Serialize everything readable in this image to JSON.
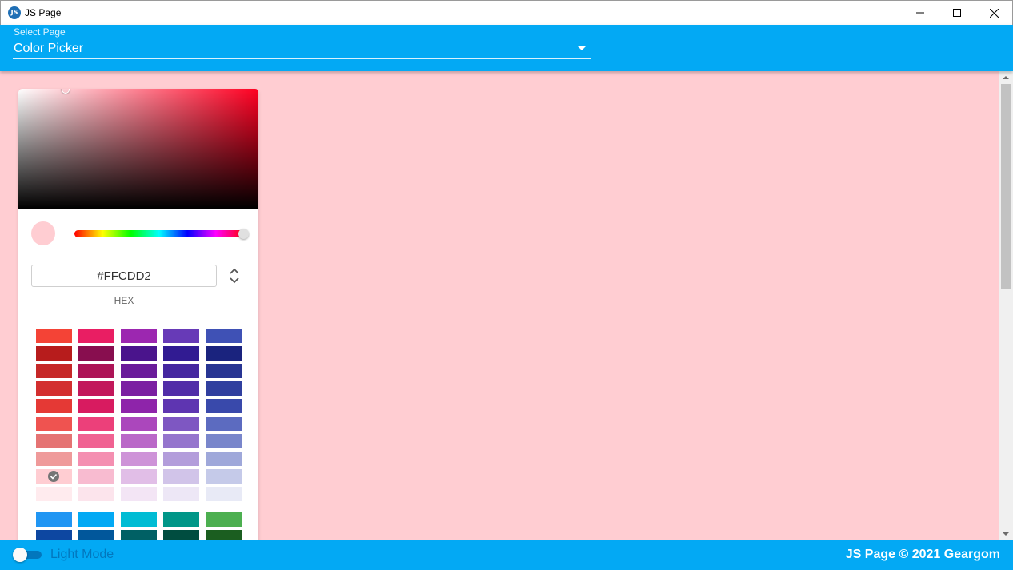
{
  "window": {
    "title": "JS Page",
    "icon_label": "JS"
  },
  "header": {
    "select_label": "Select Page",
    "select_value": "Color Picker"
  },
  "picker": {
    "preview_color": "#FFCDD2",
    "hex_value": "#FFCDD2",
    "mode_label": "HEX",
    "swatch_columns": [
      [
        "#F44336",
        "#B71C1C",
        "#C62828",
        "#D32F2F",
        "#E53935",
        "#EF5350",
        "#E57373",
        "#EF9A9A",
        "#FFCDD2",
        "#FFEBEE"
      ],
      [
        "#E91E63",
        "#880E4F",
        "#AD1457",
        "#C2185B",
        "#D81B60",
        "#EC407A",
        "#F06292",
        "#F48FB1",
        "#F8BBD0",
        "#FCE4EC"
      ],
      [
        "#9C27B0",
        "#4A148C",
        "#6A1B9A",
        "#7B1FA2",
        "#8E24AA",
        "#AB47BC",
        "#BA68C8",
        "#CE93D8",
        "#E1BEE7",
        "#F3E5F5"
      ],
      [
        "#673AB7",
        "#311B92",
        "#4527A0",
        "#512DA8",
        "#5E35B1",
        "#7E57C2",
        "#9575CD",
        "#B39DDB",
        "#D1C4E9",
        "#EDE7F6"
      ],
      [
        "#3F51B5",
        "#1A237E",
        "#283593",
        "#303F9F",
        "#3949AB",
        "#5C6BC0",
        "#7986CB",
        "#9FA8DA",
        "#C5CAE9",
        "#E8EAF6"
      ]
    ],
    "swatch_columns_2": [
      [
        "#2196F3",
        "#0D47A1"
      ],
      [
        "#03A9F4",
        "#01579B"
      ],
      [
        "#00BCD4",
        "#006064"
      ],
      [
        "#009688",
        "#004D40"
      ],
      [
        "#4CAF50",
        "#1B5E20"
      ]
    ],
    "selected_swatch": "#FFCDD2"
  },
  "footer": {
    "mode_label": "Light Mode",
    "copyright": "JS Page © 2021 Geargom"
  },
  "colors": {
    "accent": "#03A9F4",
    "background": "#FFCDD2"
  }
}
